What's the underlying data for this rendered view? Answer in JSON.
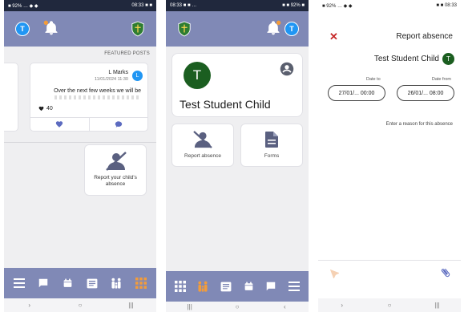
{
  "screen1": {
    "status": {
      "left": "■ 92% … ◆ ◆",
      "right": "08:33 ■ ■"
    },
    "header": {
      "avatar_letter": "T"
    },
    "featured_label": "FEATURED POSTS",
    "post": {
      "author": "L Marks",
      "avatar_letter": "L",
      "date": "11/01/2024 11:30",
      "body": "Over the next few weeks we will be",
      "likes": "40"
    },
    "report_card": {
      "label": "Report your child's absence"
    },
    "bottom_nav": [
      "menu-icon",
      "chat-icon",
      "calendar-icon",
      "news-icon",
      "family-icon",
      "grid-icon"
    ]
  },
  "screen2": {
    "status": {
      "left": "08:33 ■ ■ …",
      "right": "■ ■ 92% ■"
    },
    "student": {
      "avatar_letter": "T",
      "name": "Test Student Child"
    },
    "header": {
      "avatar_letter": "T"
    },
    "tiles": [
      {
        "label": "Report absence",
        "icon": "person-off-icon"
      },
      {
        "label": "Forms",
        "icon": "document-icon"
      }
    ],
    "bottom_nav": [
      "grid-icon",
      "family-icon",
      "news-icon",
      "calendar-icon",
      "chat-icon",
      "menu-icon"
    ]
  },
  "screen3": {
    "status": {
      "left": "■ 92% … ◆ ◆",
      "right": "■ ■ 08:33"
    },
    "title": "Report absence",
    "student": {
      "avatar_letter": "T",
      "name": "Test Student Child"
    },
    "date_from_label": "Date from",
    "date_to_label": "Date to",
    "date_from_value": "26/01/... 08:00",
    "date_to_value": "27/01/... 00:00",
    "reason_placeholder": "Enter a reason for this absence"
  },
  "colors": {
    "header": "#8089b6",
    "accent_blue": "#2196f3",
    "student_green": "#1b5e20",
    "close_red": "#c62828",
    "notification_orange": "#f39c3a"
  }
}
